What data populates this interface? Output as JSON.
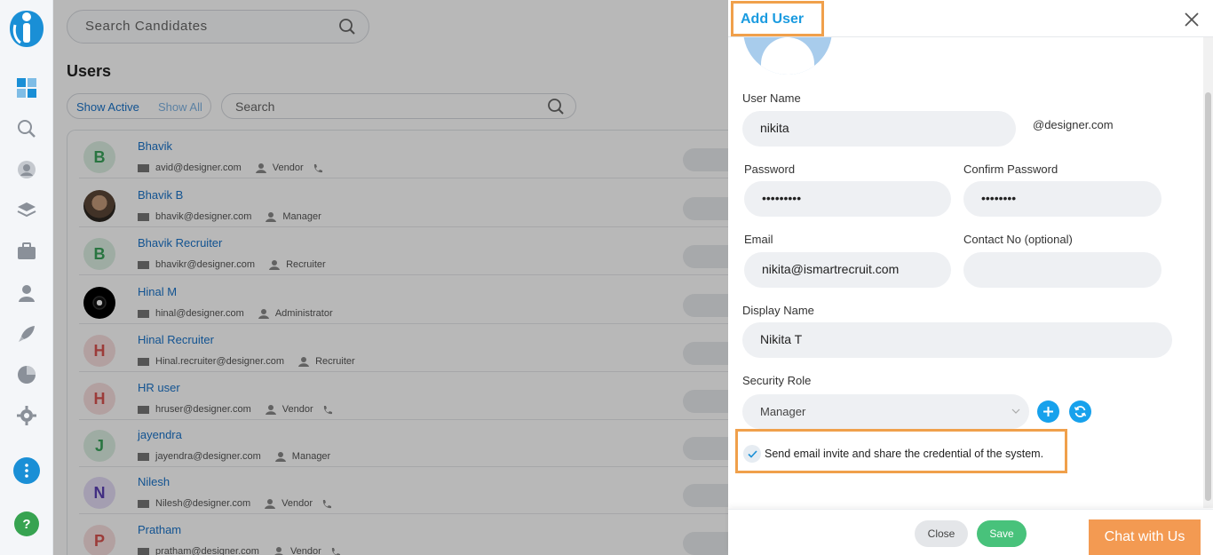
{
  "sidebar": {
    "logo_icon": "ismartrecruit-logo-icon",
    "items": [
      {
        "icon": "dashboard-icon"
      },
      {
        "icon": "search-icon"
      },
      {
        "icon": "candidate-icon"
      },
      {
        "icon": "layers-icon"
      },
      {
        "icon": "briefcase-icon"
      },
      {
        "icon": "users-icon"
      },
      {
        "icon": "rocket-icon"
      },
      {
        "icon": "pie-chart-icon"
      },
      {
        "icon": "gear-icon"
      }
    ],
    "more_icon": "more-vertical-icon",
    "help_label": "?"
  },
  "main": {
    "candidate_search_placeholder": "Search Candidates",
    "title": "Users",
    "filter": {
      "active_label": "Show Active",
      "all_label": "Show All"
    },
    "list_search_placeholder": "Search",
    "users": [
      {
        "initial": "B",
        "avatar": "letter",
        "name": "Bhavik",
        "email": "avid@designer.com",
        "role": "Vendor",
        "phone_icon": true,
        "color": "#3aa35b",
        "bg": "#dcefe2"
      },
      {
        "initial": "",
        "avatar": "photo",
        "name": "Bhavik B",
        "email": "bhavik@designer.com",
        "role": "Manager",
        "phone_icon": false,
        "color": "#fff",
        "bg": "#6b5341"
      },
      {
        "initial": "B",
        "avatar": "letter",
        "name": "Bhavik Recruiter",
        "email": "bhavikr@designer.com",
        "role": "Recruiter",
        "phone_icon": false,
        "color": "#3aa35b",
        "bg": "#dcefe2"
      },
      {
        "initial": "",
        "avatar": "dark",
        "name": "Hinal M",
        "email": "hinal@designer.com",
        "role": "Administrator",
        "phone_icon": false,
        "color": "#fff",
        "bg": "#111111"
      },
      {
        "initial": "H",
        "avatar": "letter",
        "name": "Hinal Recruiter",
        "email": "Hinal.recruiter@designer.com",
        "role": "Recruiter",
        "phone_icon": false,
        "color": "#d9534f",
        "bg": "#f7dede"
      },
      {
        "initial": "H",
        "avatar": "letter",
        "name": "HR user",
        "email": "hruser@designer.com",
        "role": "Vendor",
        "phone_icon": true,
        "color": "#d9534f",
        "bg": "#f7dede"
      },
      {
        "initial": "J",
        "avatar": "letter",
        "name": "jayendra",
        "email": "jayendra@designer.com",
        "role": "Manager",
        "phone_icon": false,
        "color": "#3aa35b",
        "bg": "#dcefe2"
      },
      {
        "initial": "N",
        "avatar": "letter",
        "name": "Nilesh",
        "email": "Nilesh@designer.com",
        "role": "Vendor",
        "phone_icon": true,
        "color": "#5b3fb5",
        "bg": "#e3dcf5"
      },
      {
        "initial": "P",
        "avatar": "letter",
        "name": "Pratham",
        "email": "pratham@designer.com",
        "role": "Vendor",
        "phone_icon": true,
        "color": "#d9534f",
        "bg": "#f7dede"
      }
    ]
  },
  "panel": {
    "title": "Add User",
    "close_icon": "close-icon",
    "username_label": "User Name",
    "username_value": "nikita",
    "domain_suffix": "@designer.com",
    "password_label": "Password",
    "password_value": "•••••••••",
    "confirm_label": "Confirm Password",
    "confirm_value": "••••••••",
    "email_label": "Email",
    "email_value": "nikita@ismartrecruit.com",
    "contact_label": "Contact No (optional)",
    "contact_value": "",
    "display_label": "Display Name",
    "display_value": "Nikita T",
    "role_label": "Security Role",
    "role_value": "Manager",
    "add_role_icon": "plus-icon",
    "refresh_icon": "refresh-icon",
    "invite_checked": true,
    "invite_text": "Send email invite and share the credential of the system.",
    "close_button": "Close",
    "save_button": "Save"
  },
  "chat_button": "Chat with Us",
  "colors": {
    "accent_blue": "#1a9be0",
    "highlight_orange": "#f0a04b",
    "save_green": "#48c27b",
    "chat_orange": "#f39a52"
  }
}
